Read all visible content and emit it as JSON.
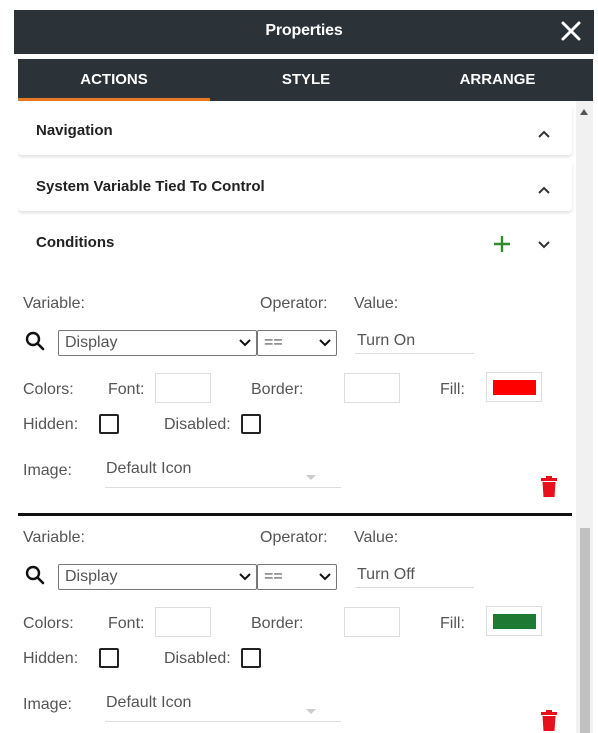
{
  "window": {
    "title": "Properties"
  },
  "tabs": [
    {
      "label": "ACTIONS",
      "active": true
    },
    {
      "label": "STYLE",
      "active": false
    },
    {
      "label": "ARRANGE",
      "active": false
    }
  ],
  "sections": {
    "navigation": {
      "label": "Navigation"
    },
    "system_variable": {
      "label": "System Variable Tied To Control"
    },
    "conditions": {
      "label": "Conditions"
    }
  },
  "labels": {
    "variable": "Variable:",
    "operator": "Operator:",
    "value": "Value:",
    "colors": "Colors:",
    "font": "Font:",
    "border": "Border:",
    "fill": "Fill:",
    "hidden": "Hidden:",
    "disabled": "Disabled:",
    "image": "Image:"
  },
  "conditions": [
    {
      "variable": "Display",
      "operator": "==",
      "value": "Turn On",
      "font_color": "",
      "border_color": "",
      "fill_color": "#ff0000",
      "hidden": false,
      "disabled": false,
      "image": "Default Icon"
    },
    {
      "variable": "Display",
      "operator": "==",
      "value": "Turn Off",
      "font_color": "",
      "border_color": "",
      "fill_color": "#1e7a32",
      "hidden": false,
      "disabled": false,
      "image": "Default Icon"
    }
  ],
  "colors": {
    "header_bg": "#2b3339",
    "tab_accent": "#e87722",
    "add_icon": "#2e8b2e",
    "delete_icon": "#e8101a"
  },
  "icons": [
    "close-icon",
    "chevron-up-icon",
    "chevron-down-icon",
    "plus-icon",
    "search-icon",
    "dropdown-arrow-icon",
    "trash-icon"
  ]
}
